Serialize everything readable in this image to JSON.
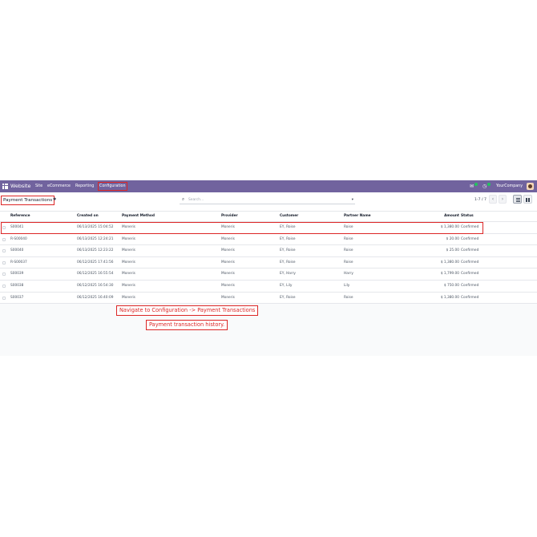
{
  "navbar": {
    "brand": "Website",
    "menu": [
      "Site",
      "eCommerce",
      "Reporting",
      "Configuration"
    ],
    "company": "YourCompany"
  },
  "control": {
    "title": "Payment Transactions",
    "search_placeholder": "Search...",
    "pager": "1-7 / 7"
  },
  "table": {
    "columns": [
      "Reference",
      "Created on",
      "Payment Method",
      "Provider",
      "Customer",
      "Partner Name",
      "Amount",
      "Status"
    ],
    "rows": [
      [
        "S00041",
        "06/13/2025 15:04:52",
        "Moneris",
        "Moneris",
        "EY, Roise",
        "Roise",
        "$ 1,380.00",
        "Confirmed"
      ],
      [
        "R-S00040",
        "06/13/2025 12:24:21",
        "Moneris",
        "Moneris",
        "EY, Roise",
        "Roise",
        "$ 20.00",
        "Confirmed"
      ],
      [
        "S00040",
        "06/13/2025 12:23:22",
        "Moneris",
        "Moneris",
        "EY, Roise",
        "Roise",
        "$ 25.00",
        "Confirmed"
      ],
      [
        "R-S00037",
        "06/12/2025 17:41:56",
        "Moneris",
        "Moneris",
        "EY, Roise",
        "Roise",
        "$ 1,380.00",
        "Confirmed"
      ],
      [
        "S00039",
        "06/12/2025 16:55:54",
        "Moneris",
        "Moneris",
        "EY, Harry",
        "Harry",
        "$ 1,799.00",
        "Confirmed"
      ],
      [
        "S00038",
        "06/12/2025 16:54:30",
        "Moneris",
        "Moneris",
        "EY, Lily",
        "Lily",
        "$ 750.00",
        "Confirmed"
      ],
      [
        "S00037",
        "06/12/2025 16:40:09",
        "Moneris",
        "Moneris",
        "EY, Roise",
        "Roise",
        "$ 1,380.00",
        "Confirmed"
      ]
    ]
  },
  "annotations": {
    "instruction": "Navigate to Configuration -> Payment Transactions",
    "caption": "Payment transaction history."
  },
  "colors": {
    "navbar": "#71639e",
    "highlight": "#dc2626"
  },
  "icons": [
    "apps-grid-icon",
    "chat-icon",
    "clock-icon",
    "gear-icon",
    "search-icon",
    "list-view-icon",
    "kanban-view-icon"
  ]
}
